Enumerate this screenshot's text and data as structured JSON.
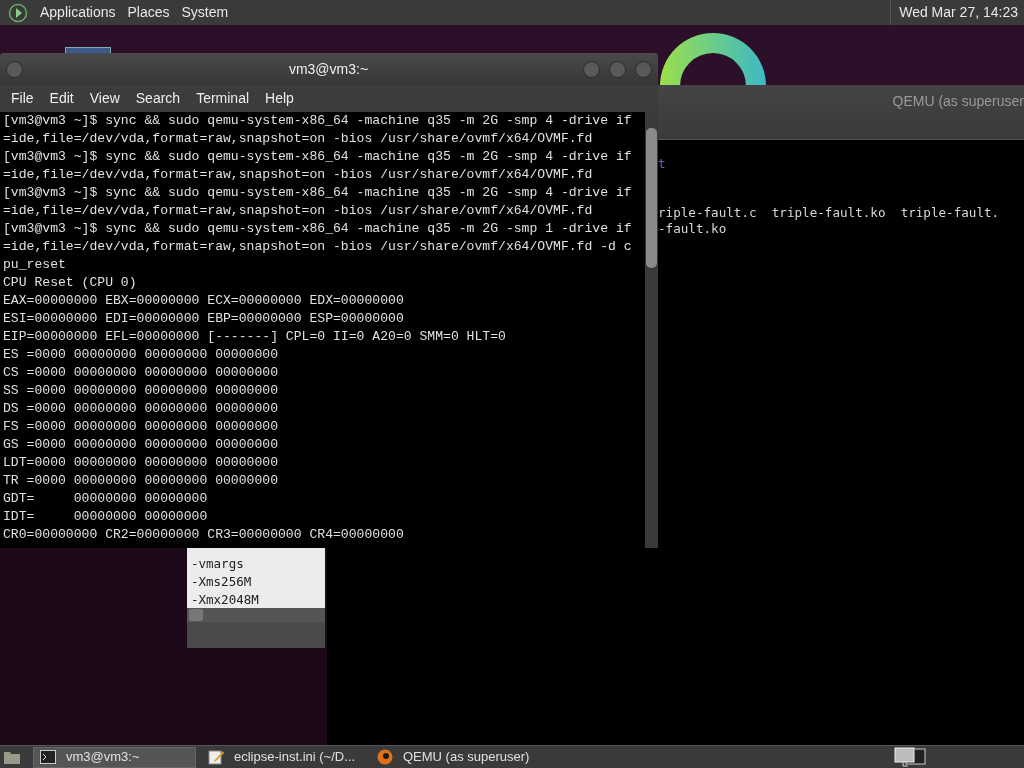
{
  "top_panel": {
    "menus": [
      "Applications",
      "Places",
      "System"
    ],
    "clock": "Wed Mar 27, 14:23"
  },
  "qemu_window": {
    "title": "QEMU (as superuser",
    "lines": [
      {
        "text": "t",
        "color": "#6b5fd0"
      },
      {
        "text": "riple-fault.c  triple-fault.ko  triple-fault.",
        "color": "#d8d8d8"
      },
      {
        "text": "-fault.ko",
        "color": "#d8d8d8"
      }
    ]
  },
  "editor_window": {
    "lines": [
      "-vmargs",
      "-Xms256M",
      "-Xmx2048M"
    ]
  },
  "terminal": {
    "title": "vm3@vm3:~",
    "menu": [
      "File",
      "Edit",
      "View",
      "Search",
      "Terminal",
      "Help"
    ],
    "lines": [
      "[vm3@vm3 ~]$ sync && sudo qemu-system-x86_64 -machine q35 -m 2G -smp 4 -drive if",
      "=ide,file=/dev/vda,format=raw,snapshot=on -bios /usr/share/ovmf/x64/OVMF.fd",
      "[vm3@vm3 ~]$ sync && sudo qemu-system-x86_64 -machine q35 -m 2G -smp 4 -drive if",
      "=ide,file=/dev/vda,format=raw,snapshot=on -bios /usr/share/ovmf/x64/OVMF.fd",
      "[vm3@vm3 ~]$ sync && sudo qemu-system-x86_64 -machine q35 -m 2G -smp 4 -drive if",
      "=ide,file=/dev/vda,format=raw,snapshot=on -bios /usr/share/ovmf/x64/OVMF.fd",
      "[vm3@vm3 ~]$ sync && sudo qemu-system-x86_64 -machine q35 -m 2G -smp 1 -drive if",
      "=ide,file=/dev/vda,format=raw,snapshot=on -bios /usr/share/ovmf/x64/OVMF.fd -d c",
      "pu_reset",
      "CPU Reset (CPU 0)",
      "EAX=00000000 EBX=00000000 ECX=00000000 EDX=00000000",
      "ESI=00000000 EDI=00000000 EBP=00000000 ESP=00000000",
      "EIP=00000000 EFL=00000000 [-------] CPL=0 II=0 A20=0 SMM=0 HLT=0",
      "ES =0000 00000000 00000000 00000000",
      "CS =0000 00000000 00000000 00000000",
      "SS =0000 00000000 00000000 00000000",
      "DS =0000 00000000 00000000 00000000",
      "FS =0000 00000000 00000000 00000000",
      "GS =0000 00000000 00000000 00000000",
      "LDT=0000 00000000 00000000 00000000",
      "TR =0000 00000000 00000000 00000000",
      "GDT=     00000000 00000000",
      "IDT=     00000000 00000000",
      "CR0=00000000 CR2=00000000 CR3=00000000 CR4=00000000"
    ]
  },
  "taskbar": {
    "tasks": [
      {
        "label": "vm3@vm3:~",
        "kind": "terminal",
        "selected": true
      },
      {
        "label": "eclipse-inst.ini (~/D...",
        "kind": "editor",
        "selected": false
      },
      {
        "label": "QEMU (as superuser)",
        "kind": "qemu",
        "selected": false
      }
    ]
  }
}
